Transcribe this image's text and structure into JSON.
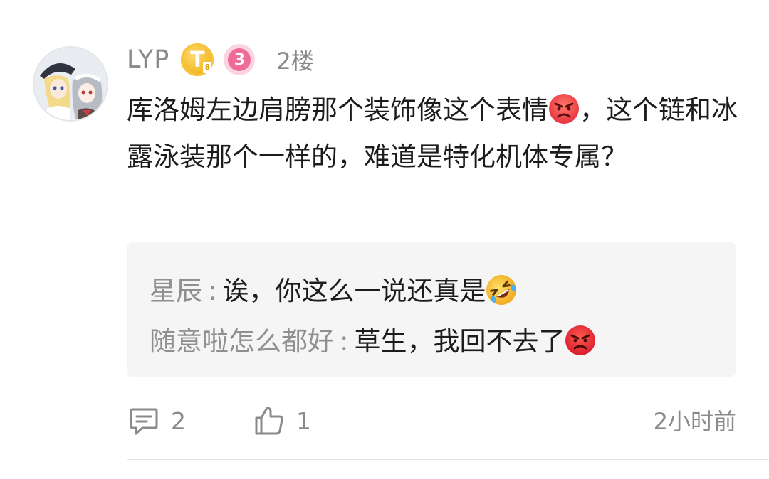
{
  "post": {
    "username": "LYP",
    "badge_t": "T",
    "badge_level": "8",
    "badge_3": "3",
    "floor": "2楼",
    "comment_part1": "库洛姆左边肩膀那个装饰像这个表情",
    "comment_part2": "，这个链和冰露泳装那个一样的，难道是特化机体专属？"
  },
  "replies": [
    {
      "name": "星辰",
      "sep": ":",
      "text": "诶，你这么一说还真是",
      "emoji": "rofl-emoji"
    },
    {
      "name": "随意啦怎么都好",
      "sep": ":",
      "text": "草生，我回不去了",
      "emoji": "angry-face-emoji"
    }
  ],
  "footer": {
    "comment_count": "2",
    "like_count": "1",
    "time": "2小时前"
  },
  "colors": {
    "meta_gray": "#8a8a8a",
    "reply_bg": "#f5f5f5",
    "badge_gold": "#f2b51e",
    "badge_pink": "#ef6b98",
    "angry_red": "#e8323f"
  },
  "icons": [
    "avatar",
    "gold-t-badge-icon",
    "pink-3-badge-icon",
    "angry-face-emoji",
    "rofl-emoji",
    "comment-icon",
    "thumbs-up-icon"
  ]
}
